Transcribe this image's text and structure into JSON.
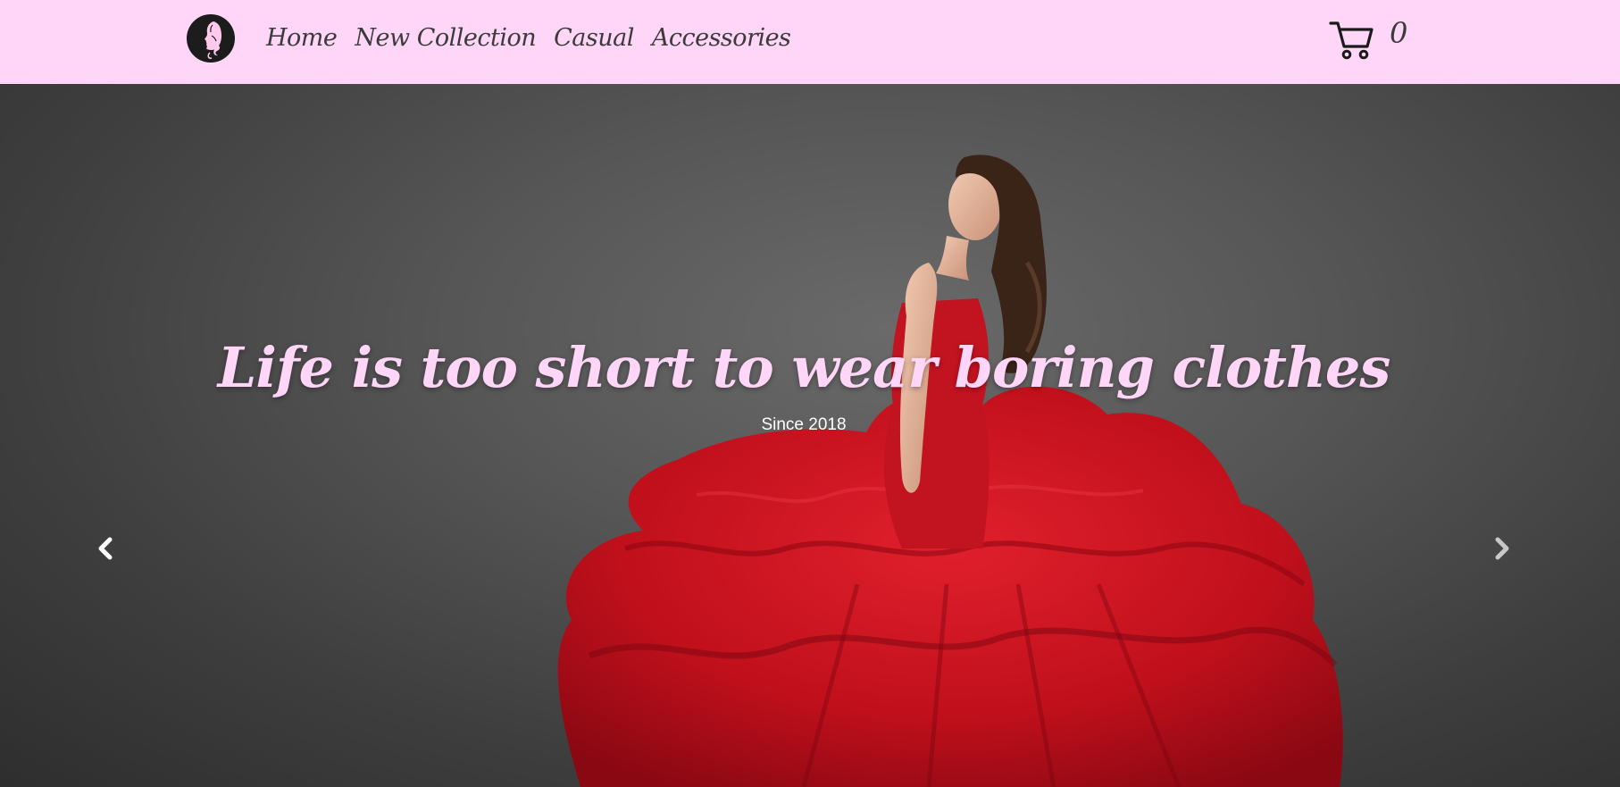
{
  "nav": {
    "links": [
      "Home",
      "New Collection",
      "Casual",
      "Accessories"
    ],
    "cart_count": "0"
  },
  "hero": {
    "headline": "Life is too short to wear boring clothes",
    "subtitle": "Since 2018"
  },
  "icons": {
    "logo": "woman-silhouette-logo",
    "cart": "shopping-cart-icon",
    "prev": "chevron-left-icon",
    "next": "chevron-right-icon"
  },
  "colors": {
    "navbar_bg": "#ffd6f8",
    "nav_text": "#3b3b3b",
    "headline": "#ffd6f8",
    "subtitle": "#ffffff",
    "dress": "#c8101e",
    "backdrop": "#4a4a4a"
  }
}
